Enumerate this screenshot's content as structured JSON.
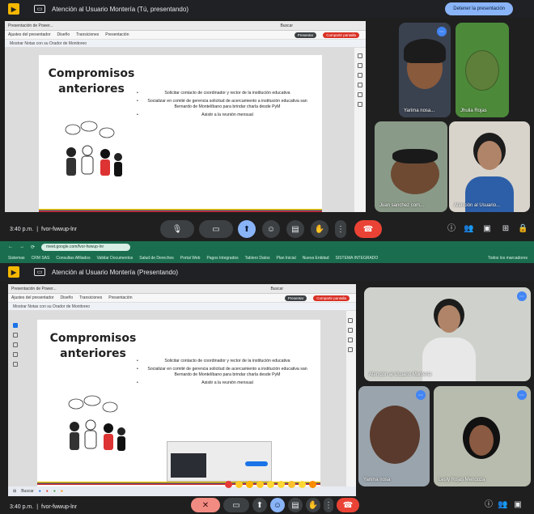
{
  "meeting": {
    "title": "Atención al Usuario Montería (Tú, presentando)",
    "title_bottom": "Atención al Usuario Montería (Presentando)",
    "stop_presenting": "Detener la presentación",
    "time": "3:40 p.m.",
    "time_bottom": "3:40 p.m.",
    "code": "fvor-fwwup-lnr",
    "code_bottom": "fvor-fwwup-lnr"
  },
  "slide": {
    "title_line1": "Compromisos",
    "title_line2": "anteriores",
    "bullets": [
      "Solicitar contacto de coordinador y rector de la institución educativa",
      "Socializar en comité de gerencia solicitud de acercamiento a institución educativa san Bernardo de Montelíbano para brindar charla desde PyM",
      "Asistir a la reunión mensual"
    ]
  },
  "ppt": {
    "tab": "Presentación de Power...",
    "ribbon": [
      "Ajustes del presentador",
      "Diseño",
      "Transiciones",
      "Presentación"
    ],
    "search": "Buscar",
    "notice": "Mostrar Notas con su Orador de Monitoreo",
    "present_btn": "Presentar",
    "share_btn": "Compartir pantalla"
  },
  "participants": [
    {
      "name": "Yarima nosa...",
      "skin": "#8a5a3c",
      "bg": "#3a4250"
    },
    {
      "name": "Jhulia Rojas",
      "skin": "#5e7f3a",
      "bg": "#4c8a3a"
    },
    {
      "name": "Juan sanchez com...",
      "skin": "#6e4a33",
      "bg": "#8a9a88"
    },
    {
      "name": "Atención al Usuario...",
      "skin": "#b08468",
      "bg": "#d8d4cc"
    }
  ],
  "participants_bottom": [
    {
      "name": "Atención al Usuario Montería",
      "skin": "#b08468",
      "bg": "#cfd2cc"
    },
    {
      "name": "Yarima nosa",
      "skin": "#5a3a2c",
      "bg": "#9aa4ad"
    },
    {
      "name": "Lesly Rojas Mendoza",
      "skin": "#8a5a42",
      "bg": "#b7bcae"
    }
  ],
  "browser": {
    "address": "meet.google.com/fvor-fwwup-lnr",
    "bookmarks": [
      "Sistemas",
      "CRM SAS",
      "Consultas Afiliados",
      "Validar Documentos",
      "Salud de Derechos",
      "Portal Web",
      "Pagos Integrados",
      "Tablero Datos",
      "Plan Inicial",
      "Nueva Entidad",
      "SISTEMA INTEGRADO"
    ],
    "right": "Todos los marcadores"
  },
  "colors": {
    "meet_dark": "#1f1f1f",
    "accent": "#8ab4f8",
    "hang": "#ea4335",
    "browser": "#1a6e4f"
  }
}
